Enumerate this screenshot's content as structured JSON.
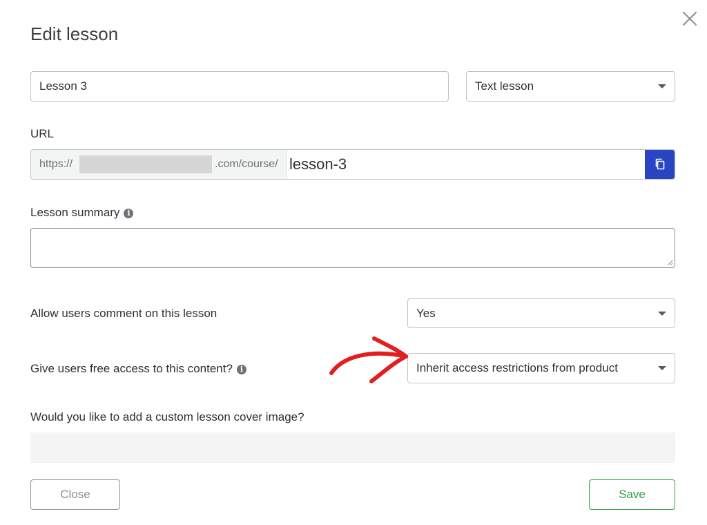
{
  "dialog": {
    "title": "Edit lesson"
  },
  "lesson_name": {
    "value": "Lesson 3"
  },
  "lesson_type": {
    "selected": "Text lesson"
  },
  "url": {
    "label": "URL",
    "prefix_start": "https://",
    "prefix_end": ".com/course/",
    "slug": "lesson-3"
  },
  "summary": {
    "label": "Lesson summary",
    "value": ""
  },
  "comments": {
    "label": "Allow users comment on this lesson",
    "selected": "Yes"
  },
  "free_access": {
    "label": "Give users free access to this content?",
    "selected": "Inherit access restrictions from product"
  },
  "cover_image": {
    "label": "Would you like to add a custom lesson cover image?"
  },
  "footer": {
    "close_label": "Close",
    "save_label": "Save"
  },
  "colors": {
    "copy_button": "#2a45c4",
    "save_accent": "#2f9e47",
    "annotation_arrow": "#e02020"
  }
}
